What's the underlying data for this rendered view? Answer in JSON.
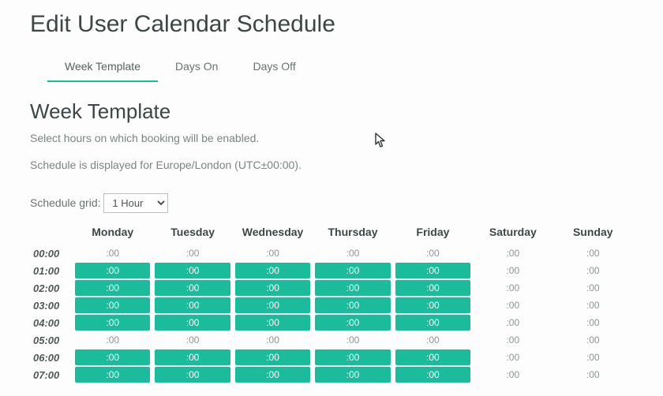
{
  "pageTitle": "Edit User Calendar Schedule",
  "tabs": [
    {
      "label": "Week Template",
      "active": true
    },
    {
      "label": "Days On",
      "active": false
    },
    {
      "label": "Days Off",
      "active": false
    }
  ],
  "sectionTitle": "Week Template",
  "helperText": "Select hours on which booking will be enabled.",
  "tzNote": "Schedule is displayed for Europe/London (UTC±00:00).",
  "gridLabel": "Schedule grid:",
  "gridValue": "1 Hour",
  "days": [
    "Monday",
    "Tuesday",
    "Wednesday",
    "Thursday",
    "Friday",
    "Saturday",
    "Sunday"
  ],
  "rows": [
    {
      "time": "00:00",
      "cells": [
        {
          "text": ":00",
          "enabled": false
        },
        {
          "text": ":00",
          "enabled": false
        },
        {
          "text": ":00",
          "enabled": false
        },
        {
          "text": ":00",
          "enabled": false
        },
        {
          "text": ":00",
          "enabled": false
        },
        {
          "text": ":00",
          "enabled": false
        },
        {
          "text": ":00",
          "enabled": false
        }
      ]
    },
    {
      "time": "01:00",
      "cells": [
        {
          "text": ":00",
          "enabled": true
        },
        {
          "text": ":00",
          "enabled": true
        },
        {
          "text": ":00",
          "enabled": true
        },
        {
          "text": ":00",
          "enabled": true
        },
        {
          "text": ":00",
          "enabled": true
        },
        {
          "text": ":00",
          "enabled": false
        },
        {
          "text": ":00",
          "enabled": false
        }
      ]
    },
    {
      "time": "02:00",
      "cells": [
        {
          "text": ":00",
          "enabled": true
        },
        {
          "text": ":00",
          "enabled": true
        },
        {
          "text": ":00",
          "enabled": true
        },
        {
          "text": ":00",
          "enabled": true
        },
        {
          "text": ":00",
          "enabled": true
        },
        {
          "text": ":00",
          "enabled": false
        },
        {
          "text": ":00",
          "enabled": false
        }
      ]
    },
    {
      "time": "03:00",
      "cells": [
        {
          "text": ":00",
          "enabled": true
        },
        {
          "text": ":00",
          "enabled": true
        },
        {
          "text": ":00",
          "enabled": true
        },
        {
          "text": ":00",
          "enabled": true
        },
        {
          "text": ":00",
          "enabled": true
        },
        {
          "text": ":00",
          "enabled": false
        },
        {
          "text": ":00",
          "enabled": false
        }
      ]
    },
    {
      "time": "04:00",
      "cells": [
        {
          "text": ":00",
          "enabled": true
        },
        {
          "text": ":00",
          "enabled": true
        },
        {
          "text": ":00",
          "enabled": true
        },
        {
          "text": ":00",
          "enabled": true
        },
        {
          "text": ":00",
          "enabled": true
        },
        {
          "text": ":00",
          "enabled": false
        },
        {
          "text": ":00",
          "enabled": false
        }
      ]
    },
    {
      "time": "05:00",
      "cells": [
        {
          "text": ":00",
          "enabled": false
        },
        {
          "text": ":00",
          "enabled": false
        },
        {
          "text": ":00",
          "enabled": false
        },
        {
          "text": ":00",
          "enabled": false
        },
        {
          "text": ":00",
          "enabled": false
        },
        {
          "text": ":00",
          "enabled": false
        },
        {
          "text": ":00",
          "enabled": false
        }
      ]
    },
    {
      "time": "06:00",
      "cells": [
        {
          "text": ":00",
          "enabled": true
        },
        {
          "text": ":00",
          "enabled": true
        },
        {
          "text": ":00",
          "enabled": true
        },
        {
          "text": ":00",
          "enabled": true
        },
        {
          "text": ":00",
          "enabled": true
        },
        {
          "text": ":00",
          "enabled": false
        },
        {
          "text": ":00",
          "enabled": false
        }
      ]
    },
    {
      "time": "07:00",
      "cells": [
        {
          "text": ":00",
          "enabled": true
        },
        {
          "text": ":00",
          "enabled": true
        },
        {
          "text": ":00",
          "enabled": true
        },
        {
          "text": ":00",
          "enabled": true
        },
        {
          "text": ":00",
          "enabled": true
        },
        {
          "text": ":00",
          "enabled": false
        },
        {
          "text": ":00",
          "enabled": false
        }
      ]
    }
  ]
}
